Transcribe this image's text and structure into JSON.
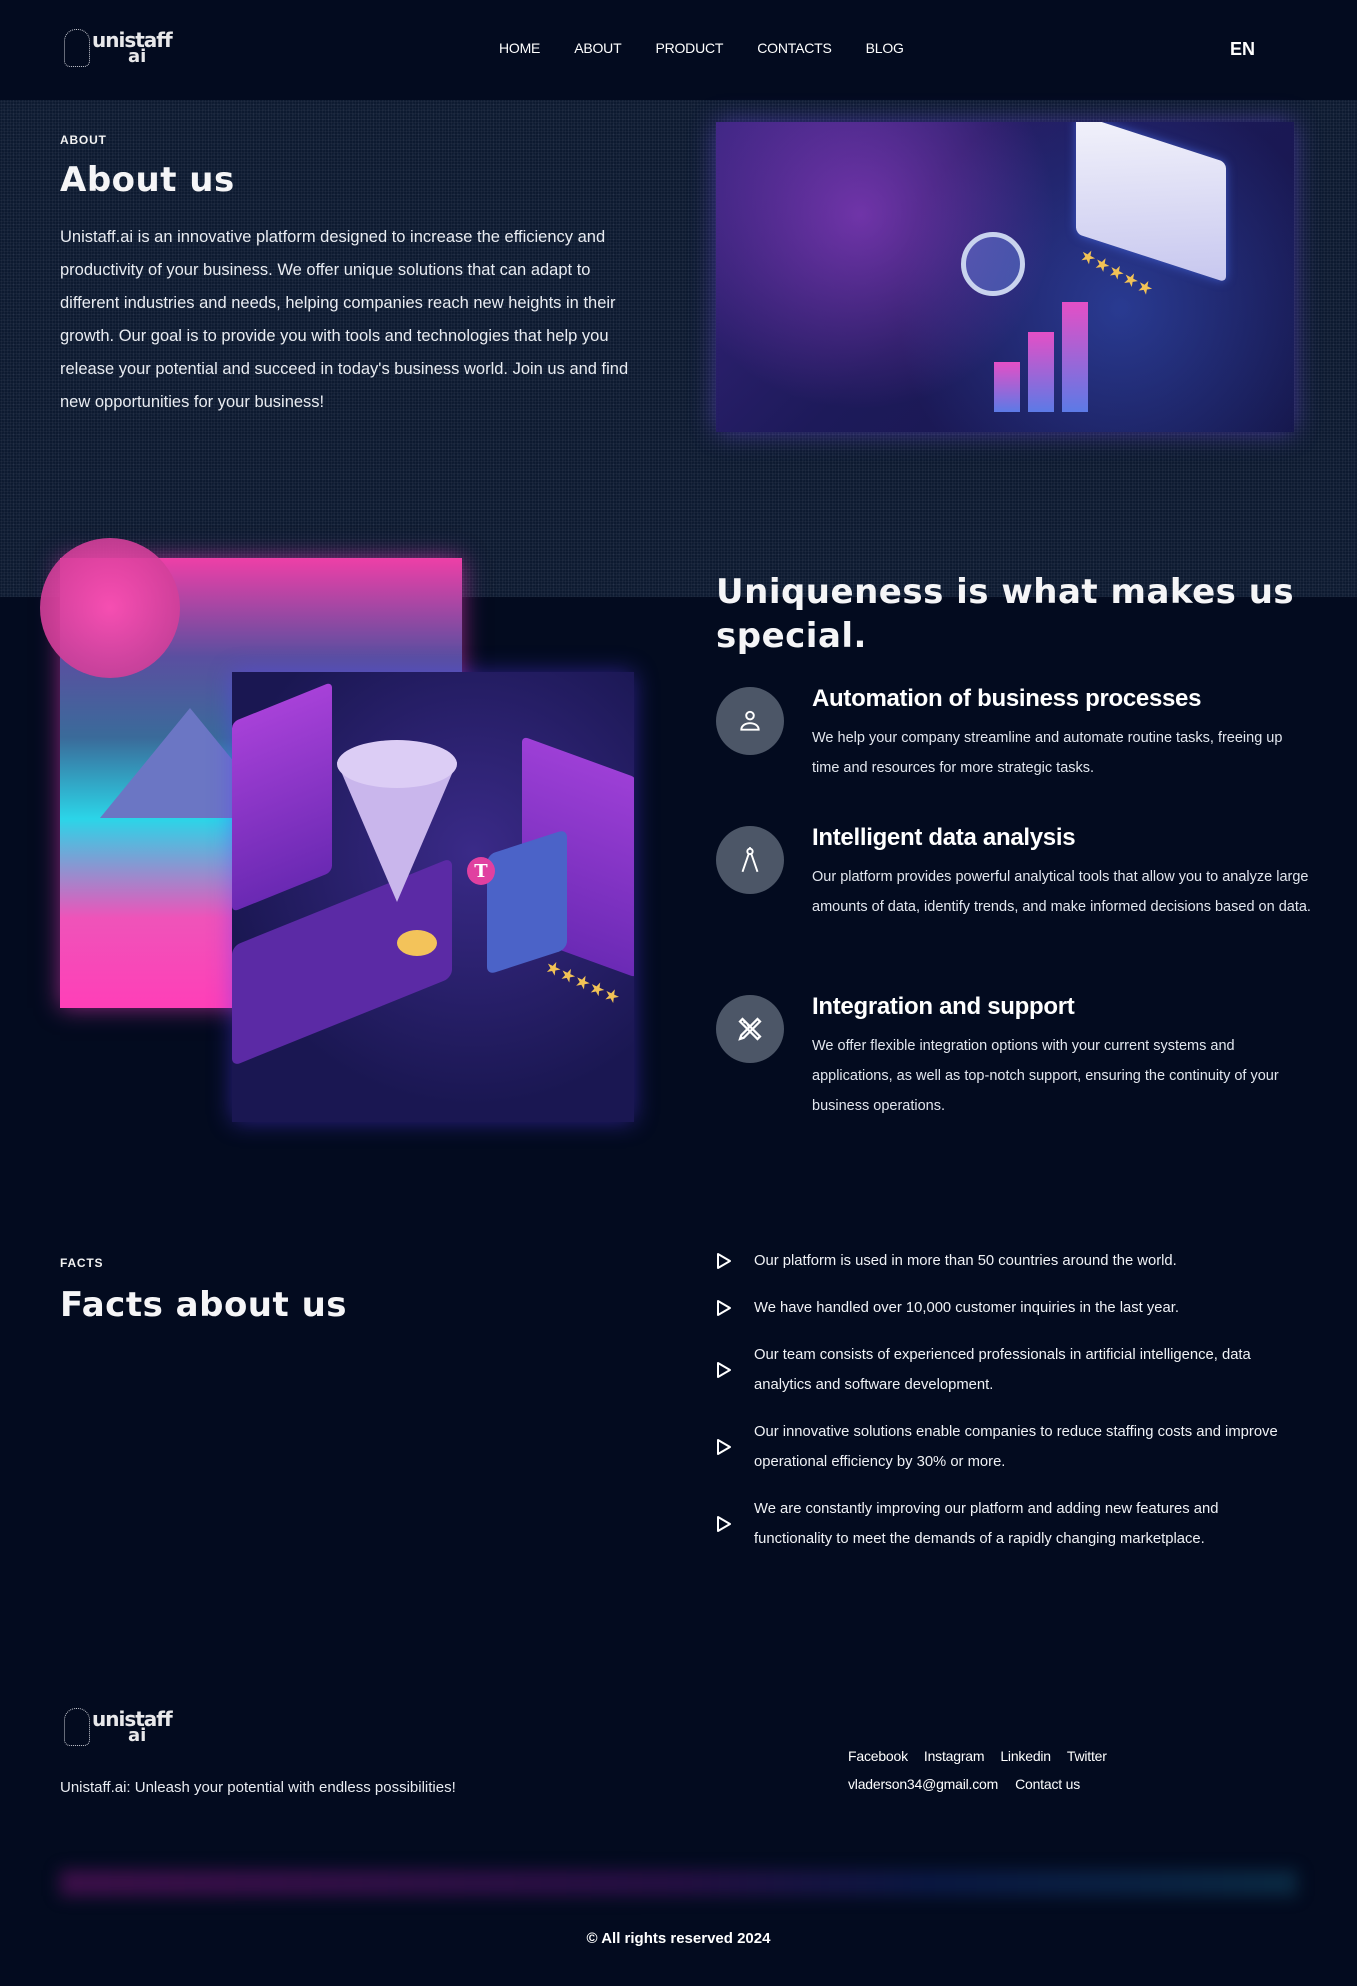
{
  "header": {
    "logo_text_top": "unistaff",
    "logo_text_bottom": "ai",
    "nav": [
      {
        "label": "HOME"
      },
      {
        "label": "ABOUT"
      },
      {
        "label": "PRODUCT"
      },
      {
        "label": "CONTACTS"
      },
      {
        "label": "BLOG"
      }
    ],
    "language": "EN"
  },
  "about": {
    "eyebrow": "ABOUT",
    "title": "About us",
    "body": "Unistaff.ai is an innovative platform designed to increase the efficiency and productivity of your business. We offer unique solutions that can adapt to different industries and needs, helping companies reach new heights in their growth. Our goal is to provide you with tools and technologies that help you release your potential and succeed in today's business world. Join us and find new opportunities for your business!",
    "image_alt": "isometric analytics illustration"
  },
  "uniqueness": {
    "title": "Uniqueness is what makes us special.",
    "features": [
      {
        "icon": "user-icon",
        "title": "Automation of business processes",
        "text": "We help your company streamline and automate routine tasks, freeing up time and resources for more strategic tasks."
      },
      {
        "icon": "compass-icon",
        "title": "Intelligent data analysis",
        "text": "Our platform provides powerful analytical tools that allow you to analyze large amounts of data, identify trends, and make informed decisions based on data."
      },
      {
        "icon": "tools-icon",
        "title": "Integration and support",
        "text": "We offer flexible integration options with your current systems and applications, as well as top-notch support, ensuring the continuity of your business operations."
      }
    ]
  },
  "facts": {
    "eyebrow": "FACTS",
    "title": "Facts about us",
    "items": [
      {
        "text": "Our platform is used in more than 50 countries around the world."
      },
      {
        "text": "We have handled over 10,000 customer inquiries in the last year."
      },
      {
        "text": "Our team consists of experienced professionals in artificial intelligence, data analytics and software development."
      },
      {
        "text": "Our innovative solutions enable companies to reduce staffing costs and improve operational efficiency by 30% or more."
      },
      {
        "text": "We are constantly improving our platform and adding new features and functionality to meet the demands of a rapidly changing marketplace."
      }
    ]
  },
  "footer": {
    "tagline": "Unistaff.ai: Unleash your potential with endless possibilities!",
    "social": [
      {
        "label": "Facebook"
      },
      {
        "label": "Instagram"
      },
      {
        "label": "Linkedin"
      },
      {
        "label": "Twitter"
      }
    ],
    "email": "vladerson34@gmail.com",
    "contact_label": "Contact us",
    "copyright": "© All rights reserved 2024"
  },
  "colors": {
    "background": "#030b1f",
    "icon_circle": "#4c5667",
    "accent_pink": "#ee3fa7",
    "accent_purple": "#6b2ab5"
  }
}
